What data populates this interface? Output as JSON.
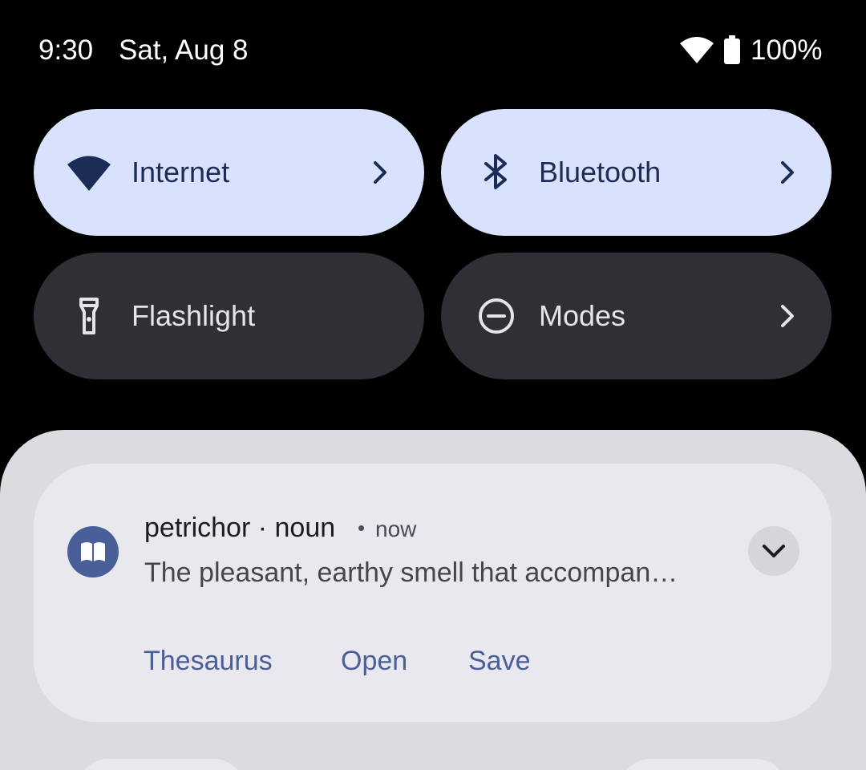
{
  "status_bar": {
    "time": "9:30",
    "date": "Sat, Aug 8",
    "battery": "100%",
    "icons": [
      "wifi-icon",
      "battery-icon"
    ]
  },
  "quick_settings": {
    "tiles": [
      {
        "label": "Internet",
        "icon": "wifi-icon",
        "state": "on",
        "has_chevron": true
      },
      {
        "label": "Bluetooth",
        "icon": "bluetooth-icon",
        "state": "on",
        "has_chevron": true
      },
      {
        "label": "Flashlight",
        "icon": "flashlight-icon",
        "state": "off",
        "has_chevron": false
      },
      {
        "label": "Modes",
        "icon": "do-not-disturb-icon",
        "state": "off",
        "has_chevron": true
      }
    ],
    "colors": {
      "tile_on": "#d8e2fc",
      "tile_off": "#2f3035",
      "on_text": "#1b2c57",
      "off_text": "#e6e4ea"
    }
  },
  "notification": {
    "app_icon": "book-icon",
    "title": "petrichor · noun",
    "separator": "•",
    "time": "now",
    "body": "The pleasant, earthy smell that accompan…",
    "actions": [
      "Thesaurus",
      "Open",
      "Save"
    ],
    "accent": "#4a5f97"
  }
}
